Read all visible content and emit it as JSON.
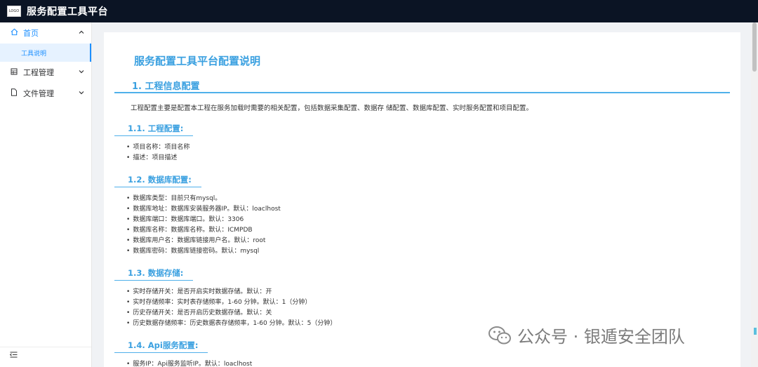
{
  "header": {
    "logo_text": "LOGO",
    "app_title": "服务配置工具平台"
  },
  "sidebar": {
    "items": [
      {
        "label": "首页",
        "icon": "home-icon",
        "expanded": true,
        "children": [
          {
            "label": "工具说明",
            "active": true
          }
        ]
      },
      {
        "label": "工程管理",
        "icon": "grid-icon",
        "expanded": false
      },
      {
        "label": "文件管理",
        "icon": "file-icon",
        "expanded": false
      }
    ],
    "collapse_icon": "menu-fold-icon"
  },
  "doc": {
    "title": "服务配置工具平台配置说明",
    "section1": {
      "heading": "1. 工程信息配置",
      "intro": "工程配置主要是配置本工程在服务加载时需要的相关配置，包括数据采集配置、数据存 储配置、数据库配置、实时服务配置和项目配置。"
    },
    "s11": {
      "heading": "1.1. 工程配置:",
      "items": [
        "项目名称：项目名称",
        "描述：项目描述"
      ]
    },
    "s12": {
      "heading": "1.2. 数据库配置:",
      "items": [
        "数据库类型：目前只有mysql。",
        "数据库地址：数据库安装服务器IP。默认：loaclhost",
        "数据库端口：数据库端口。默认：3306",
        "数据库名称：数据库名称。默认：ICMPDB",
        "数据库用户名：数据库链接用户名。默认：root",
        "数据库密码：数据库链接密码。默认：mysql"
      ]
    },
    "s13": {
      "heading": "1.3. 数据存储:",
      "items": [
        "实时存储开关：是否开启实时数据存储。默认：开",
        "实时存储频率：实时表存储频率，1-60 分钟。默认：1（分钟）",
        "历史存储开关：是否开启历史数据存储。默认：关",
        "历史数据存储频率：历史数据表存储频率，1-60 分钟。默认：5（分钟）"
      ]
    },
    "s14": {
      "heading": "1.4. Api服务配置:",
      "items": [
        "服务IP：Api服务监听IP。默认：loaclhost"
      ]
    }
  },
  "watermark": {
    "text": "公众号 · 银遁安全团队"
  }
}
